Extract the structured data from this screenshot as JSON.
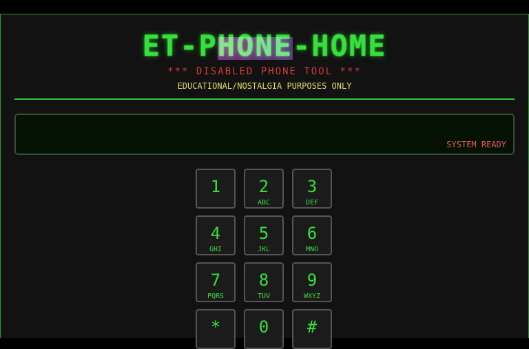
{
  "header": {
    "title_part1": "ET-P",
    "title_glitch": "HONE",
    "title_part2": "-HOME",
    "subtitle": "*** DISABLED PHONE TOOL ***",
    "note": "EDUCATIONAL/NOSTALGIA PURPOSES ONLY"
  },
  "display": {
    "value": "",
    "status": "SYSTEM READY"
  },
  "keypad": {
    "keys": [
      {
        "digit": "1",
        "letters": ""
      },
      {
        "digit": "2",
        "letters": "ABC"
      },
      {
        "digit": "3",
        "letters": "DEF"
      },
      {
        "digit": "4",
        "letters": "GHI"
      },
      {
        "digit": "5",
        "letters": "JKL"
      },
      {
        "digit": "6",
        "letters": "MNO"
      },
      {
        "digit": "7",
        "letters": "PQRS"
      },
      {
        "digit": "8",
        "letters": "TUV"
      },
      {
        "digit": "9",
        "letters": "WXYZ"
      },
      {
        "digit": "*",
        "letters": ""
      },
      {
        "digit": "0",
        "letters": ""
      },
      {
        "digit": "#",
        "letters": ""
      }
    ]
  },
  "colors": {
    "accent_green": "#35e03a",
    "warning_red": "#d33a3a",
    "note_yellow": "#e3d86a",
    "background": "#121212"
  }
}
